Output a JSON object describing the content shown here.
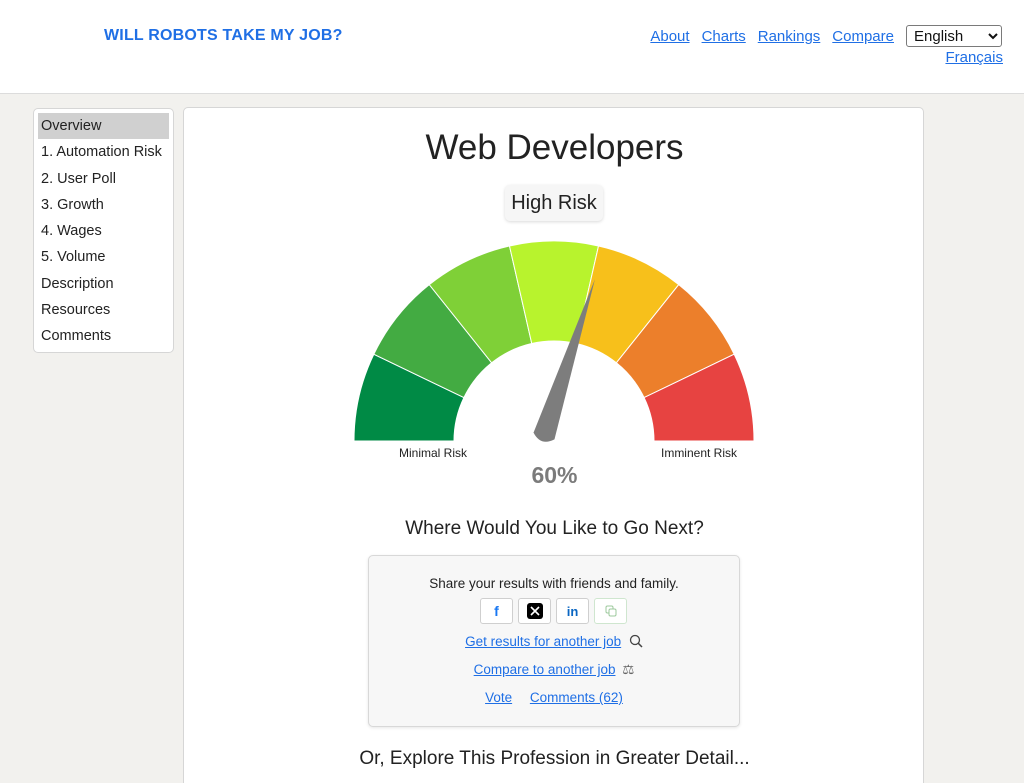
{
  "header": {
    "brand": "WILL ROBOTS TAKE MY JOB?",
    "nav": [
      "About",
      "Charts",
      "Rankings",
      "Compare"
    ],
    "language_selected": "English",
    "alt_language": "Français"
  },
  "sidebar": {
    "items": [
      {
        "label": "Overview",
        "active": true
      },
      {
        "label": "1. Automation Risk"
      },
      {
        "label": "2. User Poll"
      },
      {
        "label": "3. Growth"
      },
      {
        "label": "4. Wages"
      },
      {
        "label": "5. Volume"
      },
      {
        "label": "Description"
      },
      {
        "label": "Resources"
      },
      {
        "label": "Comments"
      }
    ]
  },
  "main": {
    "title": "Web Developers",
    "risk_label": "High Risk",
    "gauge": {
      "value_percent": 60,
      "value_text": "60%",
      "min_label": "Minimal Risk",
      "max_label": "Imminent Risk",
      "segment_colors": [
        "#008a45",
        "#43ab42",
        "#7fd037",
        "#b8f32d",
        "#f7c01b",
        "#ec7f2b",
        "#e74341"
      ]
    },
    "next_heading": "Where Would You Like to Go Next?",
    "share": {
      "text": "Share your results with friends and family.",
      "buttons": [
        "facebook-icon",
        "x-icon",
        "linkedin-icon",
        "copy-link-icon"
      ],
      "another_job_link": "Get results for another job",
      "compare_link": "Compare to another job",
      "vote_link": "Vote",
      "comments_link": "Comments (62)"
    },
    "explore_heading": "Or, Explore This Profession in Greater Detail..."
  }
}
